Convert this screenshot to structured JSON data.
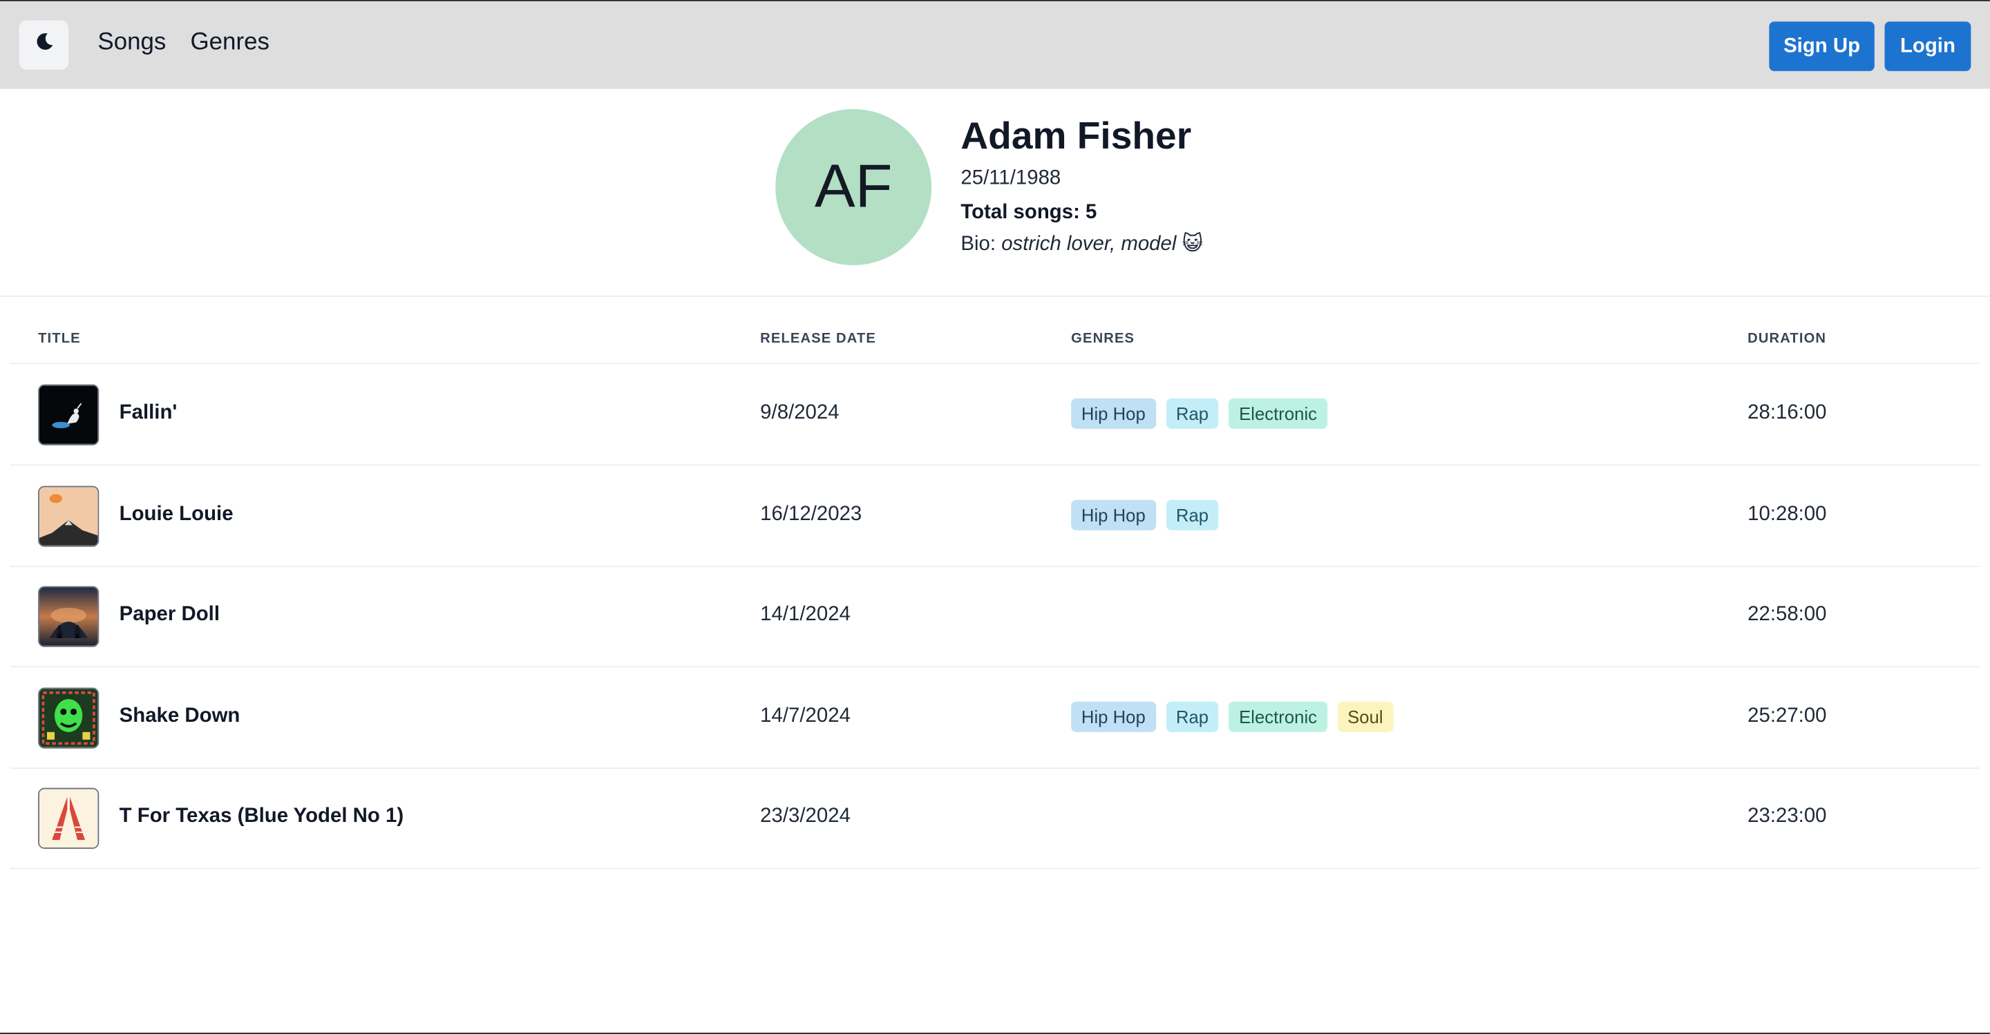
{
  "nav": {
    "theme_icon": "moon-icon",
    "links": [
      "Songs",
      "Genres"
    ],
    "signup_label": "Sign Up",
    "login_label": "Login"
  },
  "profile": {
    "initials": "AF",
    "name": "Adam Fisher",
    "birth_date": "25/11/1988",
    "total_songs": "Total songs: 5",
    "bio_label": "Bio:",
    "bio_text": "ostrich lover, model 😺",
    "avatar_color": "#b3dfc4"
  },
  "table": {
    "headers": {
      "title": "TITLE",
      "release_date": "RELEASE DATE",
      "genres": "GENRES",
      "duration": "DURATION"
    },
    "rows": [
      {
        "title": "Fallin'",
        "release_date": "9/8/2024",
        "genres": [
          "Hip Hop",
          "Rap",
          "Electronic"
        ],
        "duration": "28:16:00"
      },
      {
        "title": "Louie Louie",
        "release_date": "16/12/2023",
        "genres": [
          "Hip Hop",
          "Rap"
        ],
        "duration": "10:28:00"
      },
      {
        "title": "Paper Doll",
        "release_date": "14/1/2024",
        "genres": [],
        "duration": "22:58:00"
      },
      {
        "title": "Shake Down",
        "release_date": "14/7/2024",
        "genres": [
          "Hip Hop",
          "Rap",
          "Electronic",
          "Soul"
        ],
        "duration": "25:27:00"
      },
      {
        "title": "T For Texas (Blue Yodel No 1)",
        "release_date": "23/3/2024",
        "genres": [],
        "duration": "23:23:00"
      }
    ]
  },
  "genre_colors": {
    "Hip Hop": {
      "bg": "#bfe0f5",
      "fg": "#24425e"
    },
    "Rap": {
      "bg": "#c3eef8",
      "fg": "#21566a"
    },
    "Electronic": {
      "bg": "#bdf2e3",
      "fg": "#1e5546"
    },
    "Soul": {
      "bg": "#fcf4bf",
      "fg": "#5b4b10"
    }
  },
  "colors": {
    "navbar_bg": "#dedede",
    "button_bg": "#1d74d0"
  }
}
